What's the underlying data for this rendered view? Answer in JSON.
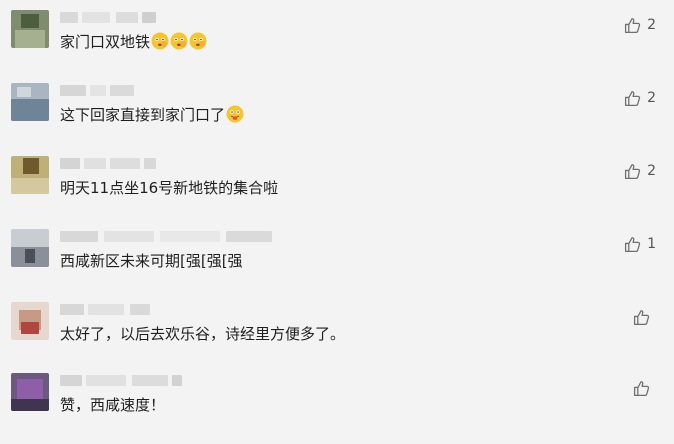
{
  "comments": [
    {
      "text": "家门口双地铁",
      "emoji_after_text": [
        "flushed-face-emoji",
        "flushed-face-emoji",
        "flushed-face-emoji"
      ],
      "likes": "2"
    },
    {
      "text": "这下回家直接到家门口了",
      "emoji_after_text": [
        "tongue-out-face-emoji"
      ],
      "likes": "2"
    },
    {
      "text": "明天11点坐16号新地铁的集合啦",
      "emoji_after_text": [],
      "likes": "2"
    },
    {
      "text": "西咸新区未来可期[强[强[强",
      "emoji_after_text": [],
      "likes": "1"
    },
    {
      "text": "太好了，以后去欢乐谷，诗经里方便多了。",
      "emoji_after_text": [],
      "likes": ""
    },
    {
      "text": "赞，西咸速度！",
      "emoji_after_text": [],
      "likes": ""
    }
  ],
  "icons": {
    "like": "thumbs-up-icon"
  },
  "colors": {
    "background": "#f3f3f3",
    "icon": "#6f6f6f",
    "text": "#1f1f1f"
  }
}
